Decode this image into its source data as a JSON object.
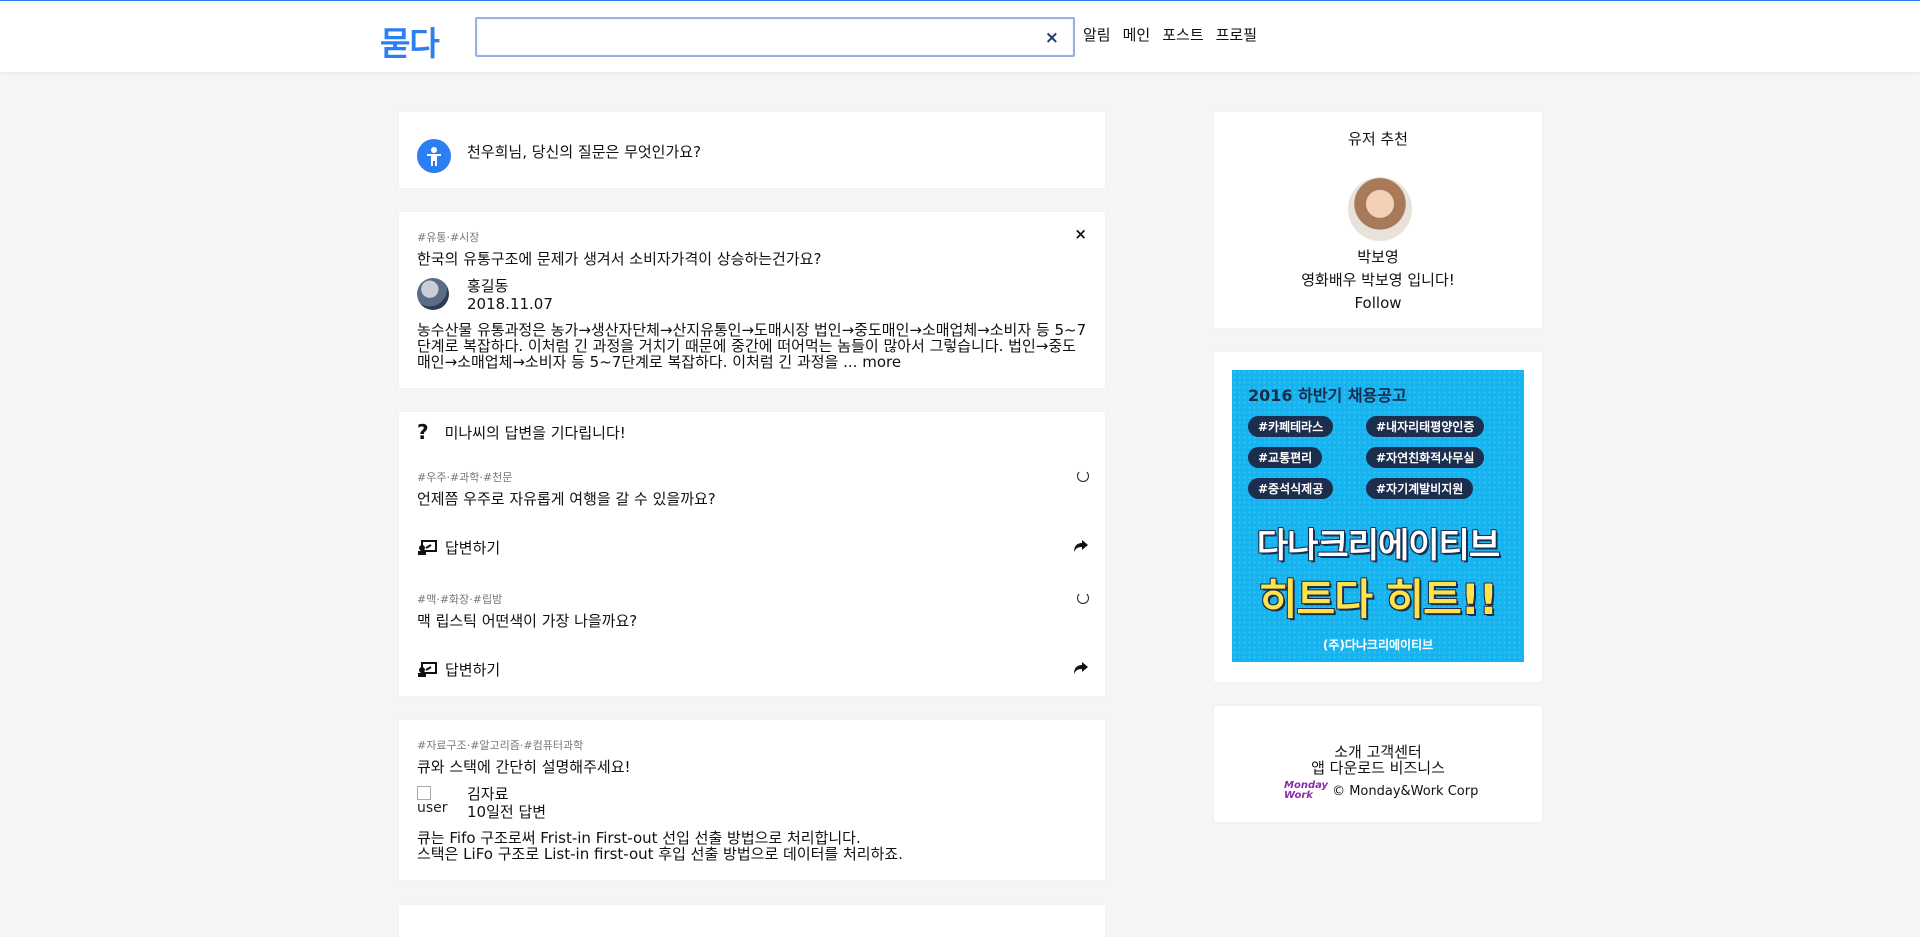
{
  "header": {
    "logo": "묻다",
    "search_value": "",
    "search_clear": "×",
    "nav": [
      "알림",
      "메인",
      "포스트",
      "프로필"
    ]
  },
  "ask": {
    "prompt": "천우희님, 당신의 질문은 무엇인가요?"
  },
  "feed": {
    "post1": {
      "tags": "#유통·#시장",
      "close": "×",
      "title": "한국의 유통구조에 문제가 생겨서 소비자가격이 상승하는건가요?",
      "author_name": "홍길동",
      "author_date": "2018.11.07",
      "body": "농수산물 유통과정은 농가→생산자단체→산지유통인→도매시장 법인→중도매인→소매업체→소비자 등 5~7단계로 복잡하다. 이처럼 긴 과정을 거치기 때문에 중간에 떠어먹는 놈들이 많아서 그렇습니다. 법인→중도매인→소매업체→소비자 등 5~7단계로 복잡하다. 이처럼 긴 과정을 ...",
      "more": "more"
    },
    "waiting": {
      "header": "미나씨의 답변을 기다립니다!",
      "items": [
        {
          "tags": "#우주·#과학·#천문",
          "title": "언제쯤 우주로 자유롭게 여행을 갈 수 있을까요?",
          "answer_label": "답변하기"
        },
        {
          "tags": "#맥·#화장·#립밤",
          "title": "맥 립스틱 어떤색이 가장 나을까요?",
          "answer_label": "답변하기"
        }
      ]
    },
    "post2": {
      "tags": "#자료구조·#알고리즘·#컴퓨터과학",
      "title": "큐와 스택에 간단히 설명해주세요!",
      "img_alt": "user",
      "author_name": "김자료",
      "author_meta": "10일전 답변",
      "body_line1": "큐는 Fifo 구조로써 Frist-in First-out 선입 선출 방법으로 처리합니다.",
      "body_line2": "스택은 LiFo 구조로 List-in first-out 후입 선출 방법으로 데이터를 처리하죠."
    }
  },
  "sidebar": {
    "recommend": {
      "title": "유저 추천",
      "name": "박보영",
      "bio": "영화배우 박보영 입니다!",
      "follow": "Follow"
    },
    "ad": {
      "heading": "2016 하반기 채용공고",
      "tags": [
        "#카페테라스",
        "#내자리태평양인증",
        "#교통편리",
        "#자연친화적사무실",
        "#중석식제공",
        "#자기계발비지원"
      ],
      "line1": "다나크리에이티브",
      "line2": "히트다 히트!!",
      "footer": "(주)다나크리에이티브"
    },
    "footer": {
      "links1": [
        "소개",
        "고객센터"
      ],
      "links2": [
        "앱 다운로드",
        "비즈니스"
      ],
      "logo_line1": "Monday",
      "logo_line2": "Work",
      "copyright": "© Monday&Work Corp"
    }
  },
  "colors": {
    "brand": "#2c7ff2",
    "background": "#f5f5f5",
    "ad_bg": "#15b3ef",
    "ad_yellow": "#ffe34a"
  },
  "icons": {
    "ask": "person-icon",
    "close": "close-icon",
    "question": "question-mark-icon",
    "spinner": "loading-icon",
    "answer": "write-answer-icon",
    "share": "share-icon"
  }
}
